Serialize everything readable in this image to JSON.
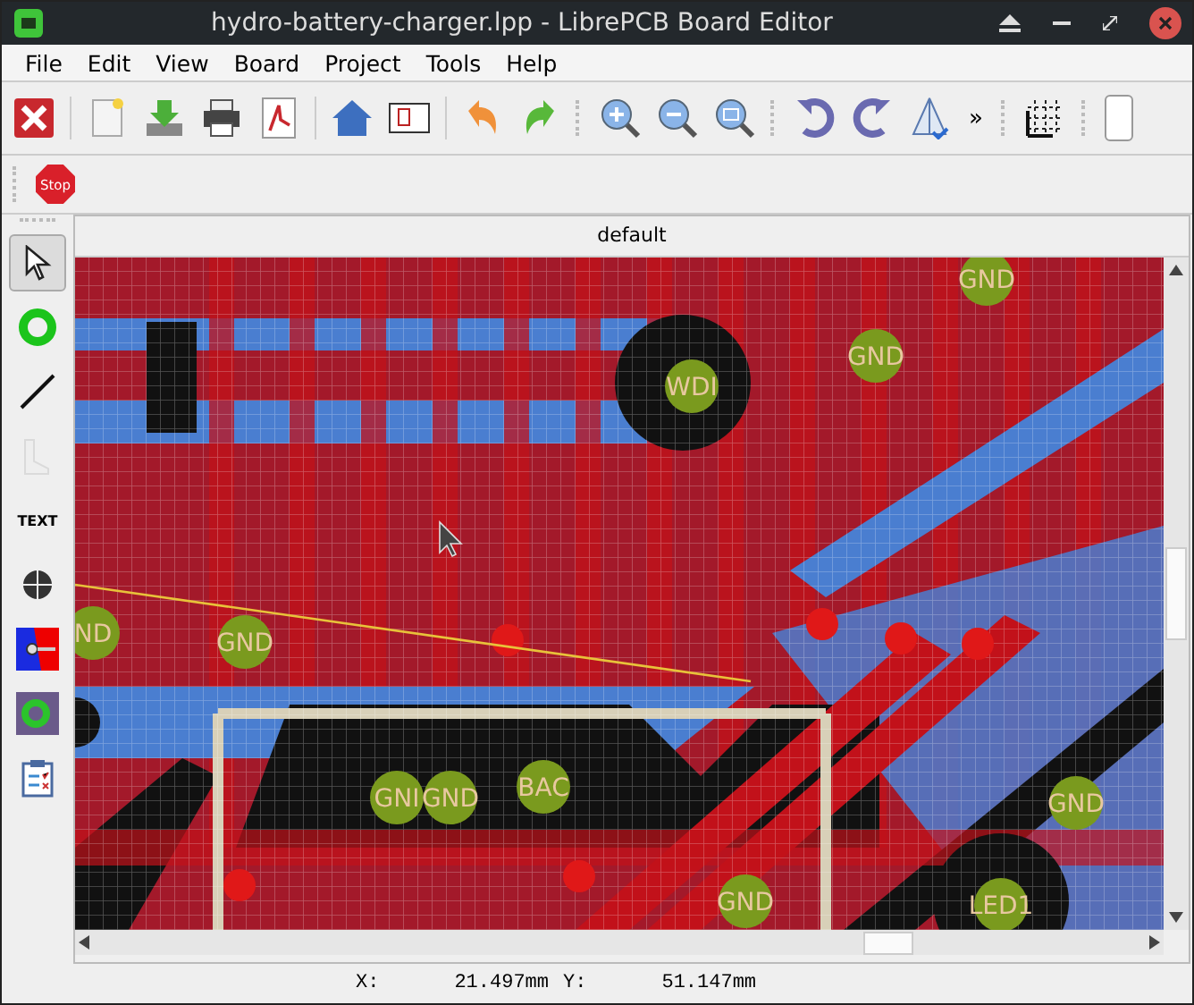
{
  "window": {
    "title": "hydro-battery-charger.lpp - LibrePCB Board Editor"
  },
  "menu": [
    "File",
    "Edit",
    "View",
    "Board",
    "Project",
    "Tools",
    "Help"
  ],
  "toolbar": [
    {
      "kind": "close-project"
    },
    {
      "kind": "separator"
    },
    {
      "kind": "new-page"
    },
    {
      "kind": "save"
    },
    {
      "kind": "print"
    },
    {
      "kind": "pdf"
    },
    {
      "kind": "separator"
    },
    {
      "kind": "home"
    },
    {
      "kind": "board"
    },
    {
      "kind": "separator"
    },
    {
      "kind": "undo"
    },
    {
      "kind": "redo"
    },
    {
      "kind": "grip"
    },
    {
      "kind": "zoom-in"
    },
    {
      "kind": "zoom-out"
    },
    {
      "kind": "zoom-fit"
    },
    {
      "kind": "grip"
    },
    {
      "kind": "rotate-ccw"
    },
    {
      "kind": "rotate-cw"
    },
    {
      "kind": "mirror"
    },
    {
      "kind": "more",
      "label": "»"
    },
    {
      "kind": "grip"
    },
    {
      "kind": "grid"
    },
    {
      "kind": "grip"
    },
    {
      "kind": "field"
    }
  ],
  "stop_label": "Stop",
  "tools": [
    {
      "kind": "select",
      "selected": true,
      "disabled": false
    },
    {
      "kind": "via",
      "selected": false,
      "disabled": false
    },
    {
      "kind": "line",
      "selected": false,
      "disabled": false
    },
    {
      "kind": "polygon",
      "selected": false,
      "disabled": true
    },
    {
      "kind": "text",
      "label": "TEXT",
      "selected": false,
      "disabled": false
    },
    {
      "kind": "hole",
      "selected": false,
      "disabled": false
    },
    {
      "kind": "plane",
      "selected": false,
      "disabled": false
    },
    {
      "kind": "component",
      "selected": false,
      "disabled": false
    },
    {
      "kind": "checklist",
      "selected": false,
      "disabled": false
    }
  ],
  "board_tab": "default",
  "pads": [
    {
      "label": "GND"
    },
    {
      "label": "WDI"
    },
    {
      "label": "GND"
    },
    {
      "label": "ND"
    },
    {
      "label": "GND"
    },
    {
      "label": "GNI"
    },
    {
      "label": "GND"
    },
    {
      "label": "BAC"
    },
    {
      "label": "GND"
    },
    {
      "label": "LED1"
    },
    {
      "label": "GND"
    }
  ],
  "status_bar": {
    "x_label": "X:",
    "x_value": "21.497mm",
    "y_label": "Y:",
    "y_value": "51.147mm"
  }
}
